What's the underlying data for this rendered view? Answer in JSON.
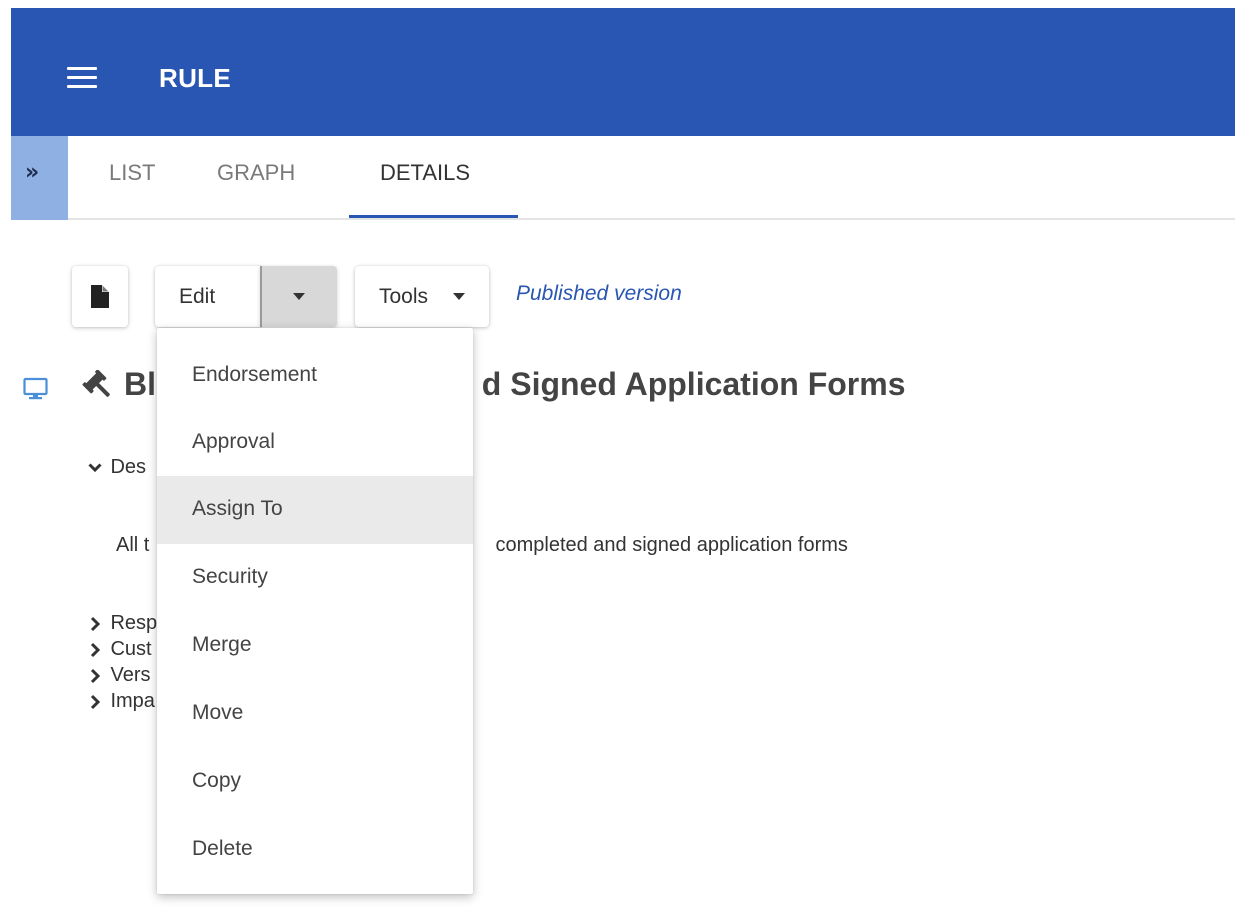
{
  "header": {
    "title": "RULE",
    "background_color": "#2956b2",
    "menu_icon": "hamburger-menu-icon"
  },
  "tabs": {
    "expander_glyph": "»",
    "items": [
      {
        "label": "LIST"
      },
      {
        "label": "GRAPH"
      },
      {
        "label": "DETAILS",
        "active": true
      }
    ]
  },
  "toolbar": {
    "document_icon": "document-icon",
    "edit_label": "Edit",
    "tools_label": "Tools",
    "version_status": "Published version"
  },
  "rule": {
    "title_visible_left": "Bl",
    "title_visible_right": "d Signed Application Forms",
    "type_icon": "gavel-icon",
    "view_icon": "monitor-icon"
  },
  "sections": {
    "description": {
      "label": "Des",
      "expanded": true
    },
    "description_text_left": "All t",
    "description_text_right": "completed and signed application forms",
    "collapsed": [
      {
        "label": "Resp"
      },
      {
        "label": "Cust"
      },
      {
        "label": "Vers"
      },
      {
        "label": "Impa"
      }
    ]
  },
  "edit_menu": {
    "items": [
      {
        "label": "Endorsement"
      },
      {
        "label": "Approval"
      },
      {
        "label": "Assign To",
        "highlighted": true
      },
      {
        "label": "Security"
      },
      {
        "label": "Merge"
      },
      {
        "label": "Move"
      },
      {
        "label": "Copy"
      },
      {
        "label": "Delete"
      }
    ]
  }
}
